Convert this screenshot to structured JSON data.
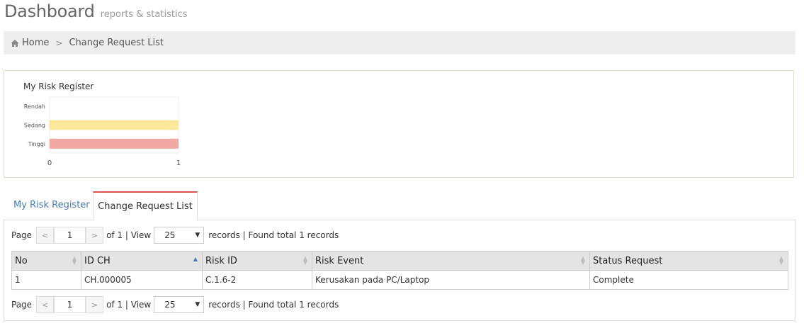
{
  "header": {
    "title": "Dashboard",
    "subtitle": "reports & statistics"
  },
  "breadcrumb": {
    "home": "Home",
    "separator": ">",
    "current": "Change Request List"
  },
  "chart_panel": {
    "title": "My Risk Register"
  },
  "chart_data": {
    "type": "bar",
    "orientation": "horizontal",
    "title": "My Risk Register",
    "categories": [
      "Rendah",
      "Sedang",
      "Tinggi"
    ],
    "values": [
      0,
      1,
      1
    ],
    "colors": [
      "#c9e6c9",
      "#fce89a",
      "#f2a8a2"
    ],
    "xlim": [
      0,
      1
    ],
    "xticks": [
      "0",
      "1"
    ]
  },
  "tabs": [
    {
      "label": "My Risk Register",
      "active": false
    },
    {
      "label": "Change Request List",
      "active": true
    }
  ],
  "pager": {
    "page_label": "Page",
    "prev": "<",
    "next": ">",
    "page_value": "1",
    "of_text": "of 1 | View",
    "view_value": "25",
    "found_text": "records | Found total 1 records"
  },
  "table": {
    "columns": [
      "No",
      "ID CH",
      "Risk ID",
      "Risk Event",
      "Status Request"
    ],
    "rows": [
      {
        "no": "1",
        "id_ch": "CH.000005",
        "risk_id": "C.1.6-2",
        "risk_event": "Kerusakan pada PC/Laptop",
        "status": "Complete"
      }
    ]
  },
  "colors": {
    "tab_active_border": "#d9534f",
    "link": "#3aa04a",
    "tab_link": "#4a7bb7"
  }
}
